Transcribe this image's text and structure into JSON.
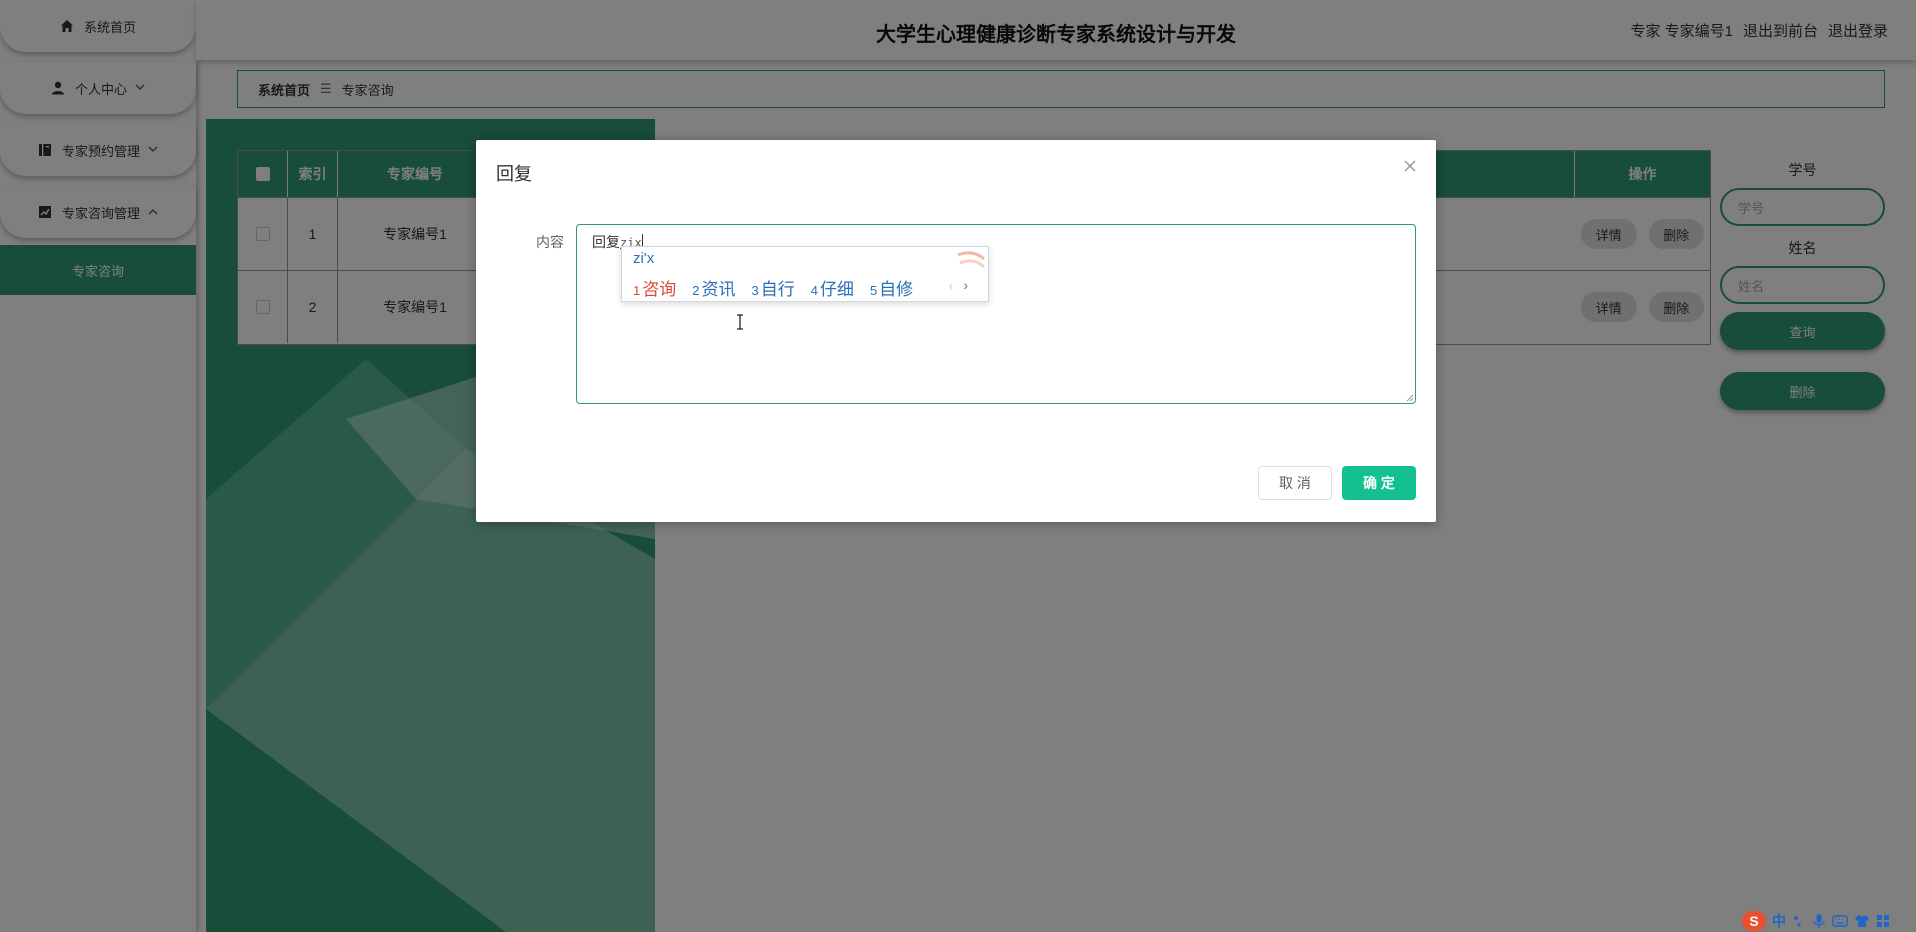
{
  "sidebar": {
    "items": [
      {
        "label": "系统首页",
        "icon": "home-icon"
      },
      {
        "label": "个人中心",
        "icon": "user-icon"
      },
      {
        "label": "专家预约管理",
        "icon": "book-icon"
      },
      {
        "label": "专家咨询管理",
        "icon": "chart-icon"
      }
    ],
    "active_sub": "专家咨询"
  },
  "header": {
    "title": "大学生心理健康诊断专家系统设计与开发",
    "user": "专家 专家编号1",
    "link_front": "退出到前台",
    "link_logout": "退出登录"
  },
  "breadcrumb": {
    "home": "系统首页",
    "separator": "☰",
    "current": "专家咨询"
  },
  "table": {
    "headers": {
      "index": "索引",
      "expert_no": "专家编号",
      "actions": "操作"
    },
    "rows": [
      {
        "index": "1",
        "expert_no": "专家编号1",
        "detail": "详情",
        "delete": "删除"
      },
      {
        "index": "2",
        "expert_no": "专家编号1",
        "detail": "详情",
        "delete": "删除"
      }
    ]
  },
  "search": {
    "student_no_label": "学号",
    "student_no_placeholder": "学号",
    "name_label": "姓名",
    "name_placeholder": "姓名",
    "query_button": "查询",
    "delete_button": "删除"
  },
  "dialog": {
    "title": "回复",
    "field_label": "内容",
    "text_value": "回复",
    "typed_pinyin": "zix",
    "cancel": "取 消",
    "confirm": "确 定"
  },
  "ime": {
    "composition": "zi'x",
    "candidates": [
      {
        "num": "1",
        "text": "咨询"
      },
      {
        "num": "2",
        "text": "资讯"
      },
      {
        "num": "3",
        "text": "自行"
      },
      {
        "num": "4",
        "text": "仔细"
      },
      {
        "num": "5",
        "text": "自修"
      }
    ],
    "prev": "‹",
    "next": "›"
  },
  "tray": {
    "logo": "S",
    "mode": "中"
  },
  "colors": {
    "primary": "#2f9a73",
    "confirm": "#13c08f",
    "ime_first": "#e0463b",
    "ime_text": "#2a6db8"
  }
}
